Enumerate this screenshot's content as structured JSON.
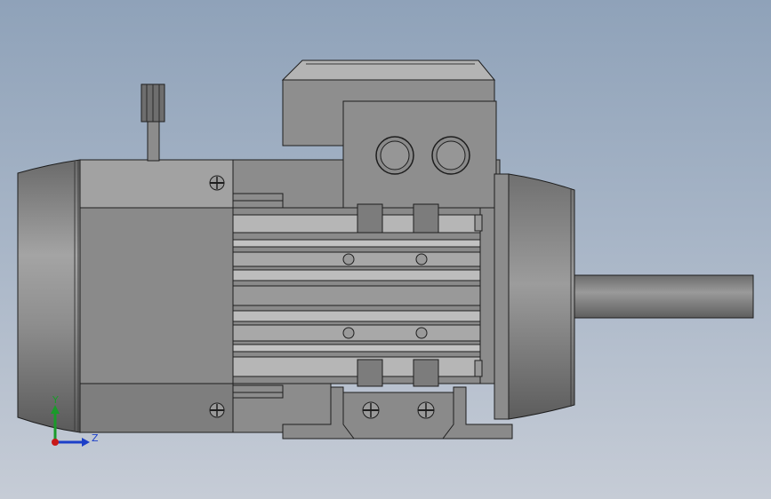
{
  "scene": {
    "model": "electric-motor-with-brake",
    "view": "side"
  },
  "triad": {
    "y_label": "Y",
    "z_label": "Z",
    "y_color": "#1a9a2a",
    "z_color": "#1c3fc8",
    "origin_color": "#c81818"
  },
  "colors": {
    "background_top": "#8fa2b9",
    "background_bottom": "#c6ccd6",
    "body_gray": "#8a8a8a",
    "outline": "#1e1e1e"
  }
}
